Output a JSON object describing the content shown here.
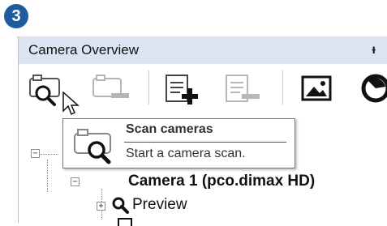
{
  "step_number": "3",
  "panel": {
    "title": "Camera Overview",
    "pin_glyph": "ᵻ"
  },
  "toolbar": {
    "buttons": [
      {
        "name": "scan-cameras",
        "icon": "camera-search-icon",
        "enabled": true
      },
      {
        "name": "remove-camera",
        "icon": "camera-minus-icon",
        "enabled": false
      },
      {
        "name": "add-item",
        "icon": "document-plus-icon",
        "enabled": true
      },
      {
        "name": "remove-item",
        "icon": "document-minus-icon",
        "enabled": false
      },
      {
        "name": "image",
        "icon": "image-icon",
        "enabled": true
      },
      {
        "name": "capture",
        "icon": "lens-icon",
        "enabled": true
      }
    ]
  },
  "tooltip": {
    "title": "Scan cameras",
    "description": "Start a camera scan."
  },
  "tree": {
    "camera_label": "Camera 1 (pco.dimax HD)",
    "preview_label": "Preview",
    "root_expander": "⊟",
    "camera_expander": "⊟",
    "preview_expander": "⊞"
  },
  "colors": {
    "badge": "#1d5d9f",
    "header_bg": "#dbe5f1"
  }
}
